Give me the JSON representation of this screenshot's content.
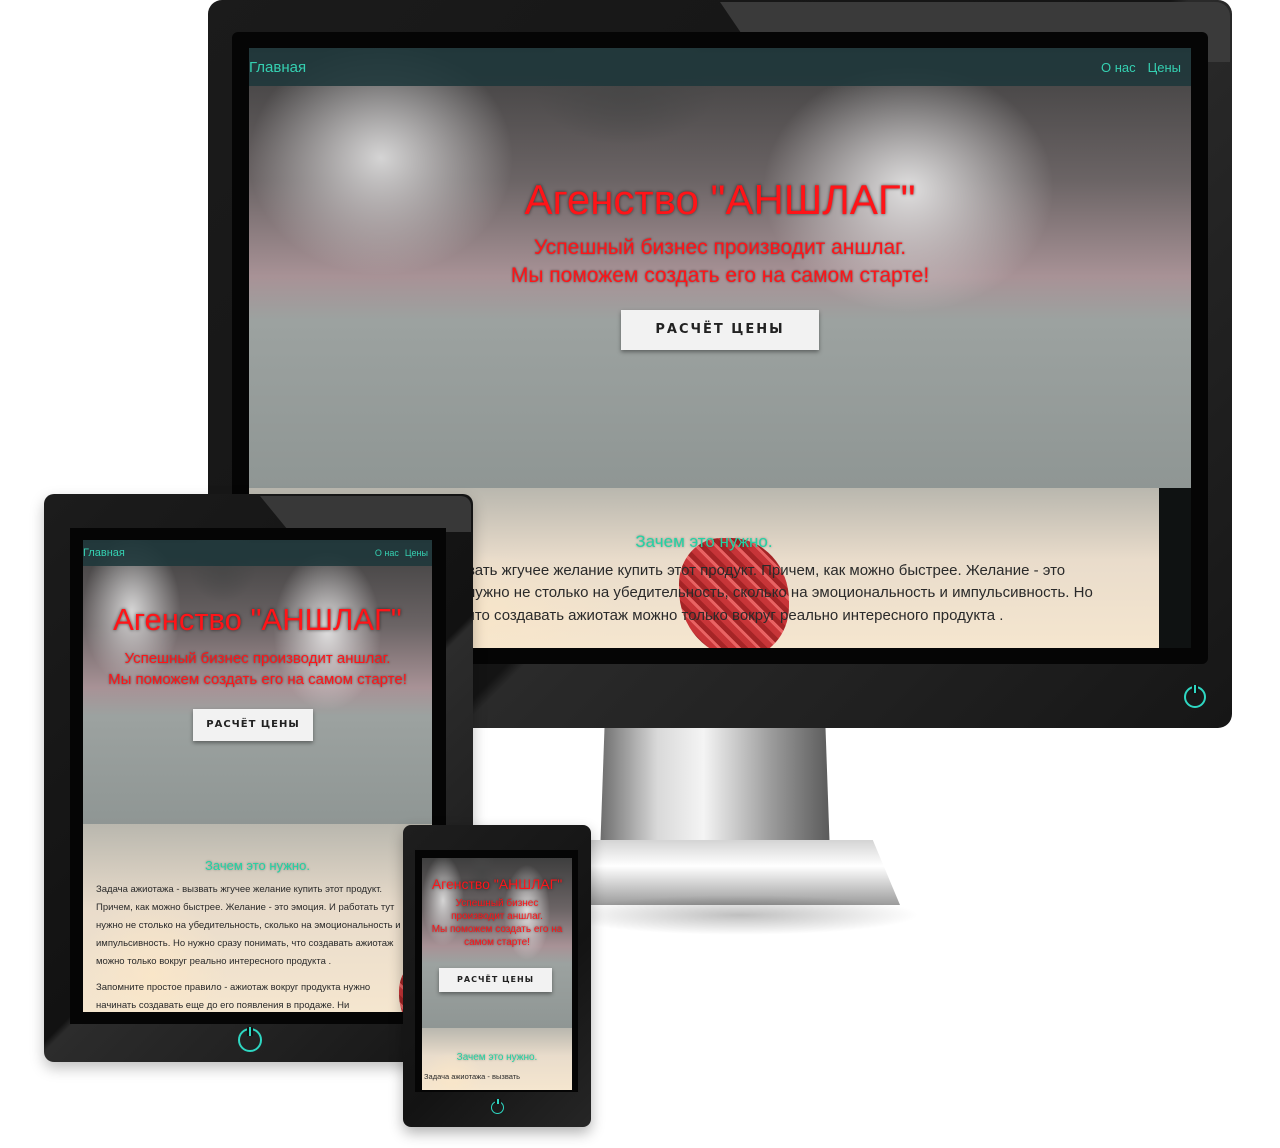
{
  "colors": {
    "accent": "#35d0b1",
    "title_red": "#ff1418",
    "button_bg": "#f2f2f2",
    "section_title": "#22d3a4"
  },
  "icons": {
    "power": "power-icon"
  },
  "desktop": {
    "nav": {
      "brand": "Главная",
      "links": [
        "О нас",
        "Цены"
      ]
    },
    "hero": {
      "title": "Агенство \"АНШЛАГ\"",
      "subtitle_line1": "Успешный бизнес производит аншлаг.",
      "subtitle_line2": "Мы поможем создать его на самом старте!",
      "button": "РАСЧЁТ ЦЕНЫ"
    },
    "section": {
      "title": "Зачем это нужно.",
      "lines": [
        "вать жгучее желание купить этот продукт. Причем, как можно быстрее. Желание - это",
        "нужно не столько на убедительность, сколько на эмоциональность и импульсивность. Но",
        "что создавать ажиотаж можно только вокруг реально интересного продукта ."
      ]
    }
  },
  "tablet": {
    "nav": {
      "brand": "Главная",
      "links": [
        "О нас",
        "Цены"
      ]
    },
    "hero": {
      "title": "Агенство \"АНШЛАГ\"",
      "subtitle_line1": "Успешный бизнес производит аншлаг.",
      "subtitle_line2": "Мы поможем создать его на самом старте!",
      "button": "РАСЧЁТ ЦЕНЫ"
    },
    "section": {
      "title": "Зачем это нужно.",
      "lines": [
        "Задача ажиотажа - вызвать жгучее желание купить этот продукт.",
        "Причем, как можно быстрее. Желание - это эмоция. И работать тут",
        "нужно не столько на убедительность, сколько на эмоциональность и",
        "импульсивность. Но нужно сразу понимать, что создавать ажиотаж",
        "можно только вокруг реально интересного продукта .",
        "Запомните простое правило - ажиотаж вокруг продукта нужно",
        "начинать создавать еще до его появления в продаже. Ни"
      ]
    }
  },
  "phone": {
    "hero": {
      "title": "Агенство \"АНШЛАГ\"",
      "subtitle_line1": "Успешный бизнес",
      "subtitle_line2": "производит аншлаг.",
      "subtitle_line3": "Мы поможем создать его на",
      "subtitle_line4": "самом старте!",
      "button": "РАСЧЁТ ЦЕНЫ"
    },
    "section": {
      "title": "Зачем это нужно.",
      "line1": "Задача ажиотажа - вызвать"
    }
  }
}
